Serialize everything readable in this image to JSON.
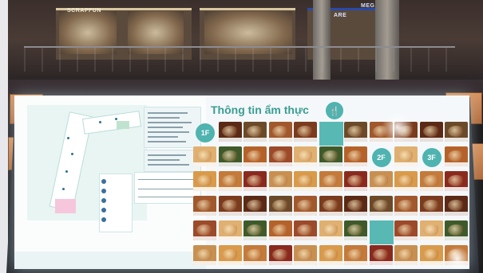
{
  "header": {
    "title": "Thông tin ẩm thực"
  },
  "floors": {
    "left_badge": "2F",
    "badge_1f": "1F",
    "badge_2f": "2F",
    "badge_3f": "3F"
  },
  "signs": {
    "store_1": "SCRAPFUN",
    "store_2": "ARE",
    "store_3": "MEGA"
  },
  "colors": {
    "accent": "#4fb3b0",
    "title": "#3a9d93",
    "map_zone": "#f6c6dc",
    "screen_bg": "#f4f8fa"
  },
  "icons": {
    "cutlery": "fork-knife-icon"
  }
}
